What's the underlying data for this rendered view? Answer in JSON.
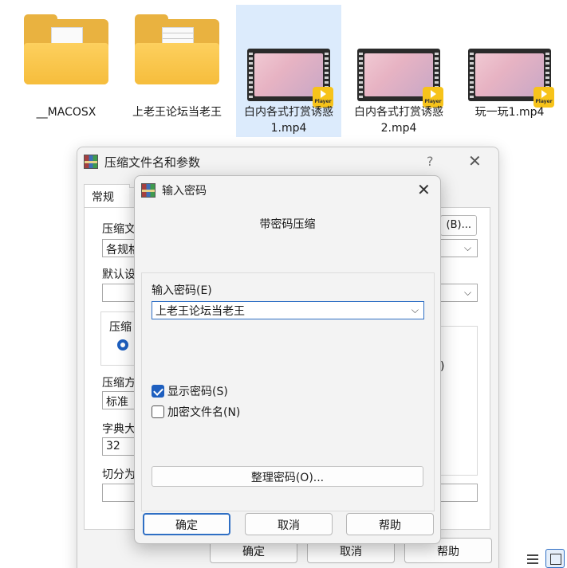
{
  "explorer": {
    "files": [
      {
        "name": "__MACOSX",
        "type": "folder"
      },
      {
        "name": "上老王论坛当老王",
        "type": "folder"
      },
      {
        "name": "白内各式打赏诱惑1.mp4",
        "type": "video",
        "selected": true,
        "badge": "Player"
      },
      {
        "name": "白内各式打赏诱惑2.mp4",
        "type": "video",
        "badge": "Player"
      },
      {
        "name": "玩一玩1.mp4",
        "type": "video",
        "badge": "Player"
      }
    ]
  },
  "back_dialog": {
    "title": "压缩文件名和参数",
    "help_glyph": "?",
    "close_glyph": "✕",
    "tab_general": "常规",
    "archive_name_label": "压缩文",
    "archive_name_value": "各规格",
    "browse_button": "(B)...",
    "default_profile_label": "默认设",
    "format_label": "压缩",
    "method_label": "压缩方",
    "method_value": "标准",
    "dictionary_label": "字典大",
    "dictionary_value": "32",
    "split_label": "切分为",
    "ok_button": "确定",
    "cancel_button": "取消",
    "help_button": "帮助"
  },
  "password_dialog": {
    "title": "输入密码",
    "close_glyph": "✕",
    "heading": "带密码压缩",
    "password_label": "输入密码(E)",
    "password_value": "上老王论坛当老王",
    "show_password": {
      "label": "显示密码(S)",
      "checked": true
    },
    "encrypt_filenames": {
      "label": "加密文件名(N)",
      "checked": false
    },
    "organize_button": "整理密码(O)...",
    "ok_button": "确定",
    "cancel_button": "取消",
    "help_button": "帮助"
  }
}
